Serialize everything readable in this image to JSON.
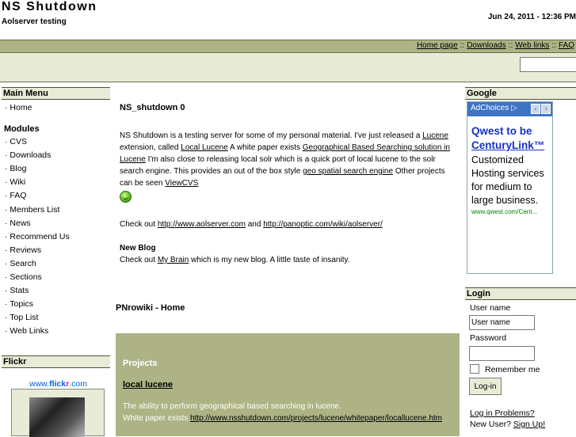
{
  "header": {
    "site_title": "NS Shutdown",
    "slogan": "Aolserver testing",
    "datetime": "Jun 24, 2011 - 12:36 PM"
  },
  "topnav": {
    "items": [
      "Home page",
      "Downloads",
      "Web links",
      "FAQ"
    ],
    "separator": "::"
  },
  "search": {
    "value": ""
  },
  "left": {
    "main_menu_title": "Main Menu",
    "main_menu_items": [
      "Home"
    ],
    "modules_title": "Modules",
    "modules_items": [
      "CVS",
      "Downloads",
      "Blog",
      "Wiki",
      "FAQ",
      "Members List",
      "News",
      "Recommend Us",
      "Reviews",
      "Search",
      "Sections",
      "Stats",
      "Topics",
      "Top List",
      "Web Links"
    ],
    "flickr_title": "Flickr",
    "flickr_logo_prefix": "www.",
    "flickr_logo_flick": "flick",
    "flickr_logo_r": "r",
    "flickr_logo_suffix": ".com"
  },
  "article": {
    "title": "NS_shutdown 0",
    "p1_a": "NS Shutdown is a testing server for some of my personal material. I've just released a ",
    "link_lucene": "Lucene",
    "p1_b": " extension, called ",
    "link_local_lucene": "Local Lucene",
    "p1_c": " A white paper exists ",
    "link_whitepaper": "Geographical Based Searching solution in Lucene",
    "p1_d": " I'm also close to releasing local solr which is a quick port of local lucene to the solr search engine. This provides an out of the box style ",
    "link_geo": "geo spatial search engine",
    "p1_e": " Other projects can be seen ",
    "link_viewcvs": "ViewCVS",
    "p2_a": "Check out ",
    "link_aolserver": "http://www.aolserver.com",
    "p2_b": " and ",
    "link_panoptic": "http://panoptic.com/wiki/aolserver/",
    "blog_title": "New Blog",
    "p3_a": "Check out ",
    "link_brain": "My Brain",
    "p3_b": " which is my new blog. A little taste of insanity."
  },
  "wiki": {
    "title": "PNrowiki - Home",
    "projects_heading": "Projects",
    "project_link": "local lucene",
    "desc_line1": "The ability to perform geographical based searching in lucene.",
    "desc_line2": "White paper exists ",
    "desc_link": "http://www.nsshutdown.com/projects/lucene/whitepaper/locallucene.htm"
  },
  "google": {
    "title": "Google",
    "adchoices": "AdChoices",
    "ad_title_line1": "Qwest to be",
    "ad_title_line2": "CenturyLink™",
    "ad_body": "Customized Hosting services for medium to large business.",
    "ad_url": "www.qwest.com/Cent..."
  },
  "login": {
    "title": "Login",
    "username_label": "User name",
    "username_value": "User name",
    "password_label": "Password",
    "password_value": "",
    "remember_label": "Remember me",
    "button": "Log-in",
    "problems_link": "Log in Problems?",
    "new_user_text": "New User? ",
    "signup_link": "Sign Up!"
  },
  "colors": {
    "accent_olive": "#aeb385",
    "light_olive": "#e8ebd5",
    "ad_blue": "#3e74c6",
    "ad_title": "#1531c9",
    "ad_url": "#008000"
  }
}
